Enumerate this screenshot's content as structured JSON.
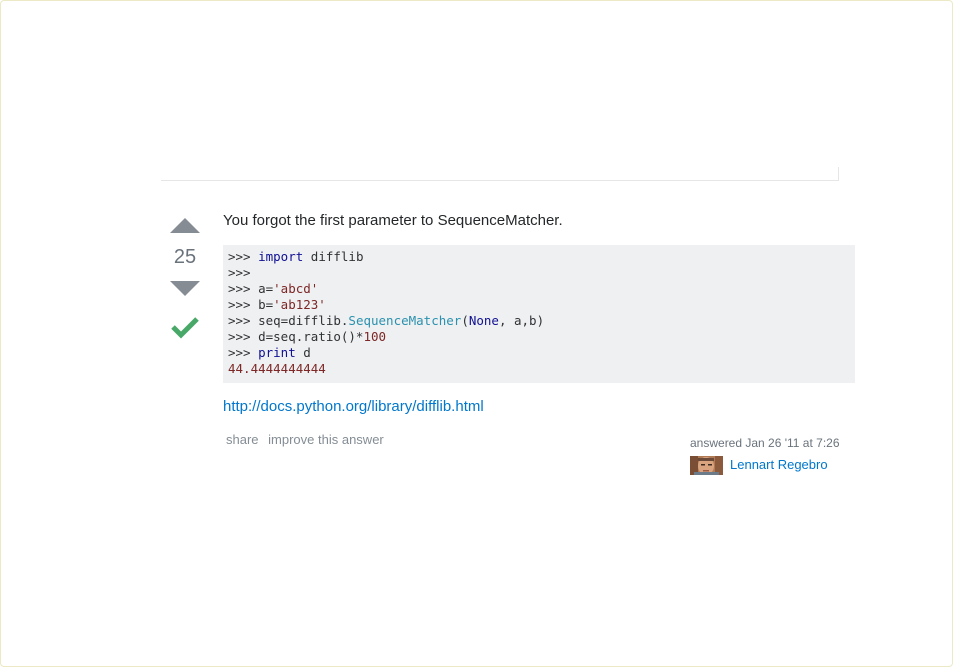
{
  "answer": {
    "vote_count": "25",
    "accepted": true,
    "intro_text": "You forgot the first parameter to SequenceMatcher.",
    "code_lines": [
      [
        {
          "t": ">>> ",
          "c": ""
        },
        {
          "t": "import",
          "c": "kw"
        },
        {
          "t": " difflib",
          "c": ""
        }
      ],
      [
        {
          "t": ">>>",
          "c": ""
        }
      ],
      [
        {
          "t": ">>> a=",
          "c": ""
        },
        {
          "t": "'abcd'",
          "c": "str"
        }
      ],
      [
        {
          "t": ">>> b=",
          "c": ""
        },
        {
          "t": "'ab123'",
          "c": "str"
        }
      ],
      [
        {
          "t": ">>> seq=difflib.",
          "c": ""
        },
        {
          "t": "SequenceMatcher",
          "c": "typ"
        },
        {
          "t": "(",
          "c": ""
        },
        {
          "t": "None",
          "c": "kw"
        },
        {
          "t": ", a,b)",
          "c": ""
        }
      ],
      [
        {
          "t": ">>> d=seq.ratio()*",
          "c": ""
        },
        {
          "t": "100",
          "c": "num"
        }
      ],
      [
        {
          "t": ">>> ",
          "c": ""
        },
        {
          "t": "print",
          "c": "kw"
        },
        {
          "t": " d",
          "c": ""
        }
      ],
      [
        {
          "t": "44.4444444444",
          "c": "num"
        }
      ]
    ],
    "link_text": "http://docs.python.org/library/difflib.html",
    "menu": {
      "share_label": "share",
      "improve_label": "improve this answer"
    },
    "signature": {
      "action_time": "answered Jan 26 '11 at 7:26",
      "user_name": "Lennart Regebro"
    }
  },
  "colors": {
    "accent_link": "#0077cc",
    "accepted_check": "#48a868",
    "vote_arrow": "#858c93"
  },
  "icons": {
    "upvote": "triangle-up-icon",
    "downvote": "triangle-down-icon",
    "accepted": "checkmark-icon"
  }
}
